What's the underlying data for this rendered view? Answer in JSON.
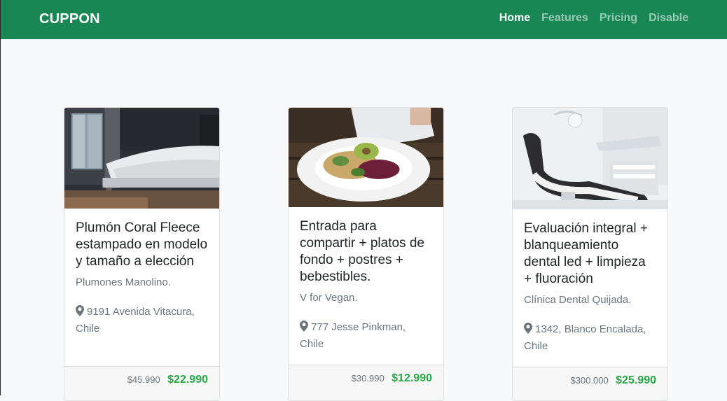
{
  "navbar": {
    "brand": "CUPPON",
    "links": [
      "Home",
      "Features",
      "Pricing",
      "Disable"
    ],
    "active": "Home",
    "color": "#198754"
  },
  "cards": [
    {
      "title": "Plumón Coral Fleece estampado en modelo y tamaño a elección",
      "merchant": "Plumones Manolino.",
      "address": "9191 Avenida Vitacura, Chile",
      "old_price": "$45.990",
      "new_price": "$22.990",
      "image": "bedroom-photo"
    },
    {
      "title": "Entrada para compartir + platos de fondo + postres + bebestibles.",
      "merchant": "V for Vegan.",
      "address": "777 Jesse Pinkman, Chile",
      "old_price": "$30.990",
      "new_price": "$12.990",
      "image": "vegan-food-photo"
    },
    {
      "title": "Evaluación integral + blanqueamiento dental led + limpieza + fluoración",
      "merchant": "Clínica Dental Quijada.",
      "address": "1342, Blanco Encalada, Chile",
      "old_price": "$300.000",
      "new_price": "$25.990",
      "image": "dental-clinic-photo"
    }
  ],
  "icons": {
    "location": "map-marker-icon"
  },
  "colors": {
    "price_green": "#28a745",
    "muted": "#6c757d"
  }
}
